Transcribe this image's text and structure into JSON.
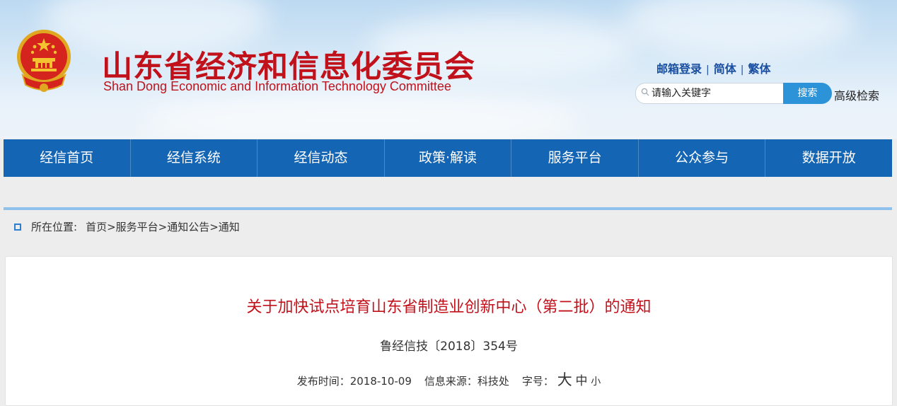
{
  "header": {
    "title_cn": "山东省经济和信息化委员会",
    "title_en": "Shan Dong Economic and Information Technology Committee",
    "links": [
      "邮箱登录",
      "简体",
      "繁体"
    ],
    "search": {
      "placeholder": "请输入关键字",
      "button": "搜索",
      "advanced": "高级检索"
    }
  },
  "nav": {
    "items": [
      "经信首页",
      "经信系统",
      "经信动态",
      "政策·解读",
      "服务平台",
      "公众参与",
      "数据开放"
    ]
  },
  "breadcrumb": {
    "label": "所在位置:",
    "items": [
      "首页>",
      "服务平台>",
      "通知公告>",
      "通知"
    ]
  },
  "article": {
    "title": "关于加快试点培育山东省制造业创新中心（第二批）的通知",
    "doc_no": "鲁经信技〔2018〕354号",
    "meta": {
      "publish": "发布时间：2018-10-09",
      "source": "信息来源：科技处",
      "fontsize_label": "字号：",
      "sizes": [
        "大",
        "中",
        "小"
      ]
    }
  },
  "colors": {
    "brand_red": "#c1111b",
    "nav_blue": "#1565b5",
    "link_blue": "#1a4fa0",
    "search_btn": "#2c93d8"
  }
}
